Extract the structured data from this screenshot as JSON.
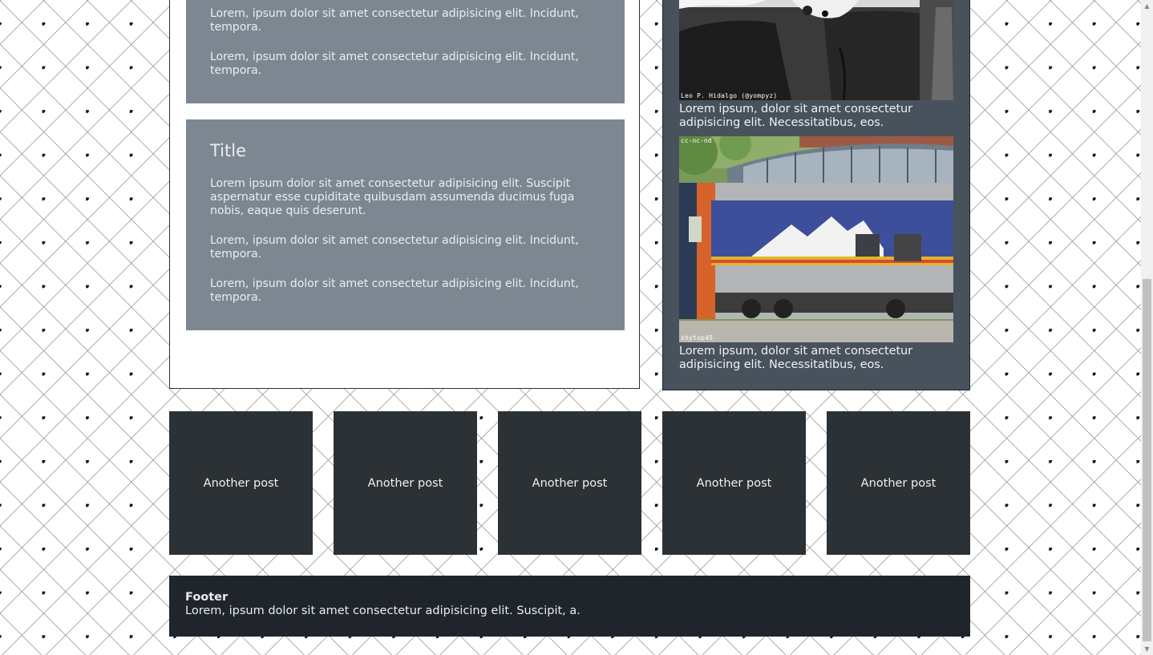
{
  "main": {
    "cards": [
      {
        "title": "",
        "paragraphs": [
          "Lorem, ipsum dolor sit amet consectetur adipisicing elit. Incidunt, tempora.",
          "Lorem, ipsum dolor sit amet consectetur adipisicing elit. Incidunt, tempora."
        ]
      },
      {
        "title": "Title",
        "paragraphs": [
          "Lorem ipsum dolor sit amet consectetur adipisicing elit. Suscipit aspernatur esse cupiditate quibusdam assumenda ducimus fuga nobis, eaque quis deserunt.",
          "Lorem, ipsum dolor sit amet consectetur adipisicing elit. Incidunt, tempora.",
          "Lorem, ipsum dolor sit amet consectetur adipisicing elit. Incidunt, tempora."
        ]
      }
    ]
  },
  "sidebar": {
    "photos": [
      {
        "credit": "Leo P. Hidalgo (@yompyz)",
        "caption": "Lorem ipsum, dolor sit amet consectetur adipisicing elit. Necessitatibus, eos."
      },
      {
        "credit_top": "cc-nc-nd",
        "credit": "shytop45",
        "caption": "Lorem ipsum, dolor sit amet consectetur adipisicing elit. Necessitatibus, eos."
      }
    ]
  },
  "posts": [
    {
      "label": "Another post"
    },
    {
      "label": "Another post"
    },
    {
      "label": "Another post"
    },
    {
      "label": "Another post"
    },
    {
      "label": "Another post"
    }
  ],
  "footer": {
    "title": "Footer",
    "text": "Lorem, ipsum dolor sit amet consectetur adipisicing elit. Suscipit, a."
  },
  "colors": {
    "card_bg": "#7d8791",
    "sidebar_bg": "#48525c",
    "post_bg": "#2b3134",
    "footer_bg": "#1f252b"
  }
}
